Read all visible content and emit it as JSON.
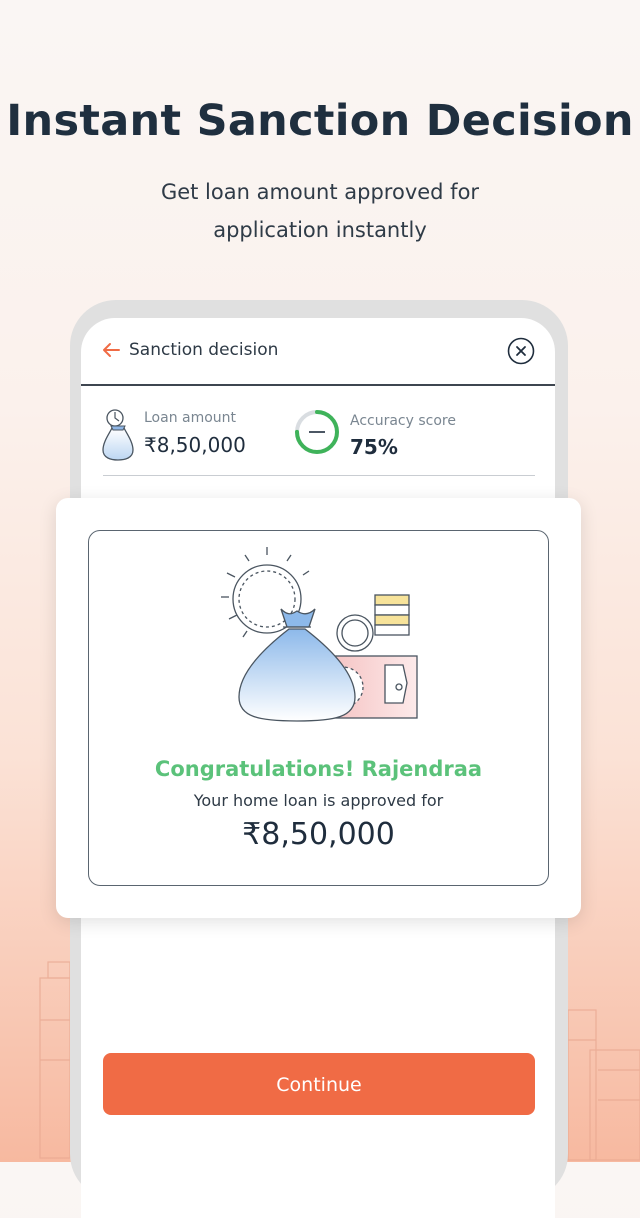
{
  "promo": {
    "headline": "Instant Sanction Decision",
    "sub_line1": "Get loan amount approved for",
    "sub_line2": "application instantly"
  },
  "header": {
    "title": "Sanction decision",
    "back_icon": "arrow-left-icon",
    "close_icon": "close-circle-icon"
  },
  "stats": {
    "loan_label": "Loan amount",
    "loan_value": "₹8,50,000",
    "accuracy_label": "Accuracy score",
    "accuracy_value": "75%",
    "accuracy_fraction": 0.75
  },
  "approval": {
    "congrats": "Congratulations! Rajendraa",
    "message": "Your home loan is approved for",
    "amount": "₹8,50,000"
  },
  "actions": {
    "continue_label": "Continue"
  },
  "colors": {
    "accent": "#f06b45",
    "success": "#5bc27a",
    "ring_track": "#d9dde1"
  }
}
